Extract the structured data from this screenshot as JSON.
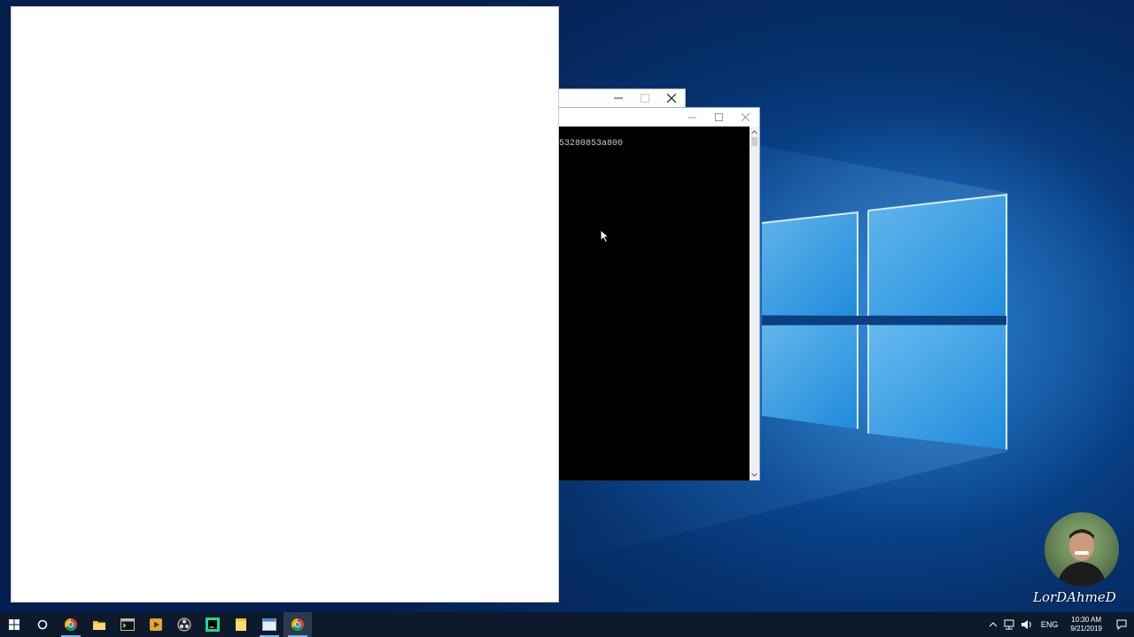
{
  "console": {
    "output_line": "53280853a800"
  },
  "watermark": {
    "name": "LorDAhmeD"
  },
  "taskbar": {
    "pinned": [
      {
        "name": "chrome",
        "icon": "chrome-icon",
        "running": true
      },
      {
        "name": "file-explorer",
        "icon": "folder-icon",
        "running": false
      },
      {
        "name": "command-prompt",
        "icon": "terminal-icon",
        "running": false
      },
      {
        "name": "media-player",
        "icon": "media-player-icon",
        "running": false
      },
      {
        "name": "obs",
        "icon": "obs-icon",
        "running": false
      },
      {
        "name": "pycharm",
        "icon": "pycharm-icon",
        "running": false
      },
      {
        "name": "notes",
        "icon": "sticky-notes-icon",
        "running": false
      },
      {
        "name": "console-app",
        "icon": "window-app-icon",
        "running": true
      },
      {
        "name": "chrome-active",
        "icon": "chrome-icon",
        "running": true
      }
    ],
    "tray": {
      "language": "ENG",
      "time": "10:30 AM",
      "date": "9/21/2019"
    }
  },
  "colors": {
    "taskbar_bg": "#0d1a2b",
    "accent": "#76b9ed",
    "wallpaper": "#0a4791",
    "console_bg": "#000000",
    "console_text": "#c6c6c6"
  }
}
